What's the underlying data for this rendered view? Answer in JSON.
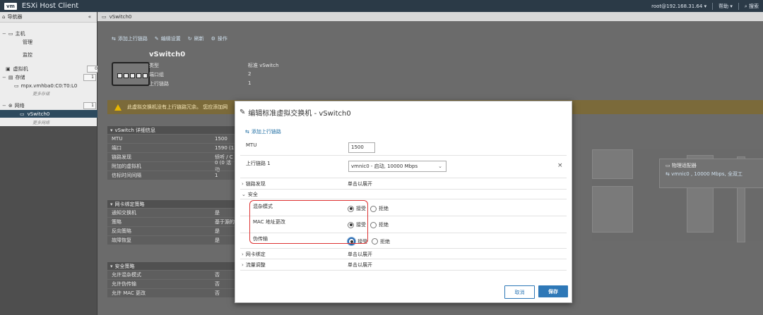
{
  "app": {
    "logo": "vm",
    "title": "ESXi Host Client",
    "user": "root@192.168.31.64",
    "help": "帮助",
    "search": "搜索"
  },
  "sidebar": {
    "title": "导航器",
    "host": "主机",
    "manage": "管理",
    "monitor": "监控",
    "vms": "虚拟机",
    "vms_count": "0",
    "storage": "存储",
    "storage_count": "1",
    "datastore": "mpx.vmhba0:C0:T0:L0",
    "more_storage": "更多存储",
    "network": "网络",
    "network_count": "1",
    "vswitch": "vSwitch0",
    "more_network": "更多网络"
  },
  "main": {
    "breadcrumb": "vSwitch0",
    "toolbar": {
      "add_uplink": "添加上行链路",
      "edit": "编辑设置",
      "refresh": "刷新",
      "actions": "操作"
    },
    "summary": {
      "name": "vSwitch0",
      "rows": [
        {
          "label": "类型",
          "value": "标准 vSwitch"
        },
        {
          "label": "端口组",
          "value": "2"
        },
        {
          "label": "上行链路",
          "value": "1"
        }
      ]
    },
    "warning": "此虚拟交换机没有上行链路冗余。 您应添加网",
    "details_panel": {
      "title": "vSwitch 详细信息",
      "rows": [
        {
          "label": "MTU",
          "value": "1500"
        },
        {
          "label": "端口",
          "value": "1590 (1"
        },
        {
          "label": "链路发现",
          "value": "侦听 / C"
        },
        {
          "label": "附加的虚拟机",
          "value": "0 (0 活动"
        },
        {
          "label": "信标时间间隔",
          "value": "1"
        }
      ]
    },
    "nic_panel": {
      "title": "网卡绑定策略",
      "rows": [
        {
          "label": "通知交换机",
          "value": "是"
        },
        {
          "label": "策略",
          "value": "基于源的"
        },
        {
          "label": "反向策略",
          "value": "是"
        },
        {
          "label": "故障恢复",
          "value": "是"
        }
      ]
    },
    "security_panel": {
      "title": "安全策略",
      "rows": [
        {
          "label": "允许混杂模式",
          "value": "否"
        },
        {
          "label": "允许伪传输",
          "value": "否"
        },
        {
          "label": "允许 MAC 更改",
          "value": "否"
        }
      ]
    },
    "adapter": {
      "title": "物理适配器",
      "nic": "vmnic0 , 10000 Mbps, 全双工"
    }
  },
  "modal": {
    "title": "编辑标准虚拟交换机 - vSwitch0",
    "add_uplink": "添加上行链路",
    "mtu_label": "MTU",
    "mtu_value": "1500",
    "uplink_label": "上行链路 1",
    "uplink_value": "vmnic0 - 启动, 10000 Mbps",
    "link_discovery_label": "链路发现",
    "expand_text": "单击以展开",
    "security_label": "安全",
    "promiscuous_label": "混杂模式",
    "mac_change_label": "MAC 地址更改",
    "forged_label": "伪传输",
    "accept": "接受",
    "reject": "拒绝",
    "nic_team_label": "网卡绑定",
    "traffic_label": "流量调整",
    "cancel": "取消",
    "save": "保存"
  }
}
